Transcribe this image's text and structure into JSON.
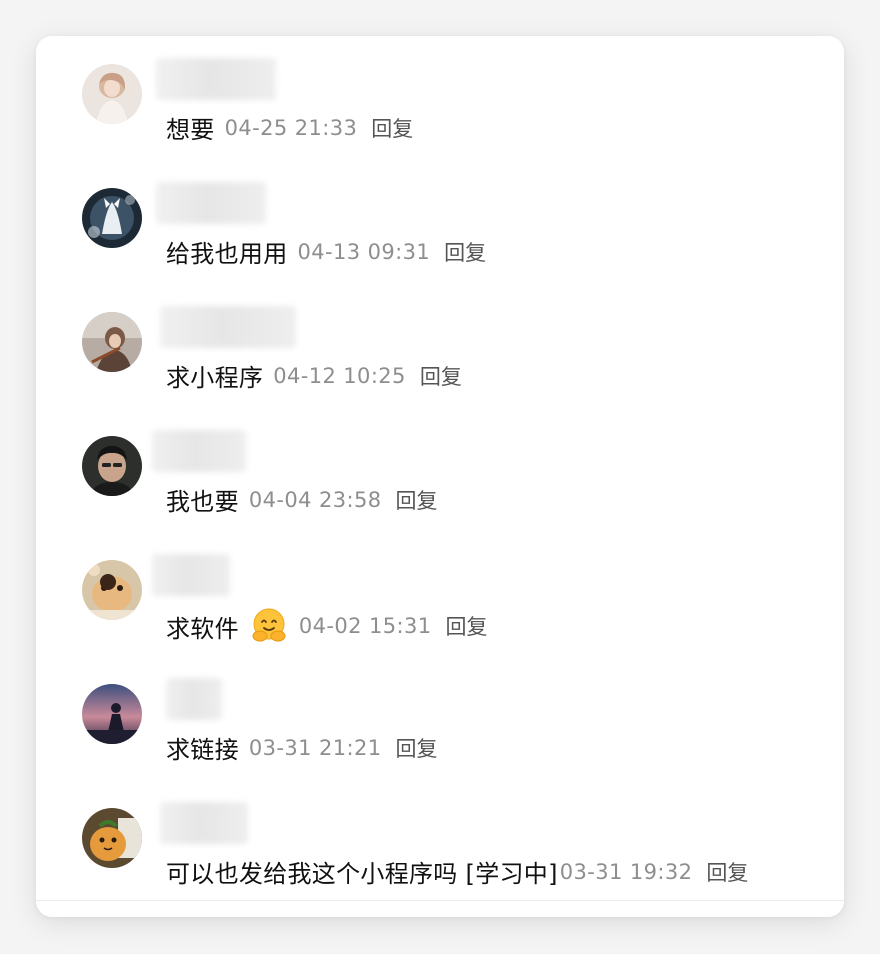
{
  "comments": [
    {
      "text": "想要",
      "time": "04-25 21:33",
      "reply_label": "回复",
      "avatar_icon": "avatar-girl-photo-icon"
    },
    {
      "text": "给我也用用",
      "time": "04-13 09:31",
      "reply_label": "回复",
      "avatar_icon": "avatar-anime-fox-icon"
    },
    {
      "text": "求小程序",
      "time": "04-12 10:25",
      "reply_label": "回复",
      "avatar_icon": "avatar-violin-photo-icon"
    },
    {
      "text": "我也要",
      "time": "04-04 23:58",
      "reply_label": "回复",
      "avatar_icon": "avatar-man-face-icon"
    },
    {
      "text": "求软件",
      "time": "04-02 15:31",
      "reply_label": "回复",
      "avatar_icon": "avatar-dog-photo-icon",
      "emoji": "hug-emoji-icon"
    },
    {
      "text": "求链接",
      "time": "03-31 21:21",
      "reply_label": "回复",
      "avatar_icon": "avatar-sunset-silhouette-icon"
    },
    {
      "text": "可以也发给我这个小程序吗 [学习中]",
      "time": "03-31 19:32",
      "reply_label": "回复",
      "avatar_icon": "avatar-plush-toy-icon"
    }
  ],
  "colors": {
    "text": "#111111",
    "time": "#8e8e8e",
    "reply": "#555555",
    "card_bg": "#ffffff",
    "page_bg": "#f4f4f5"
  }
}
